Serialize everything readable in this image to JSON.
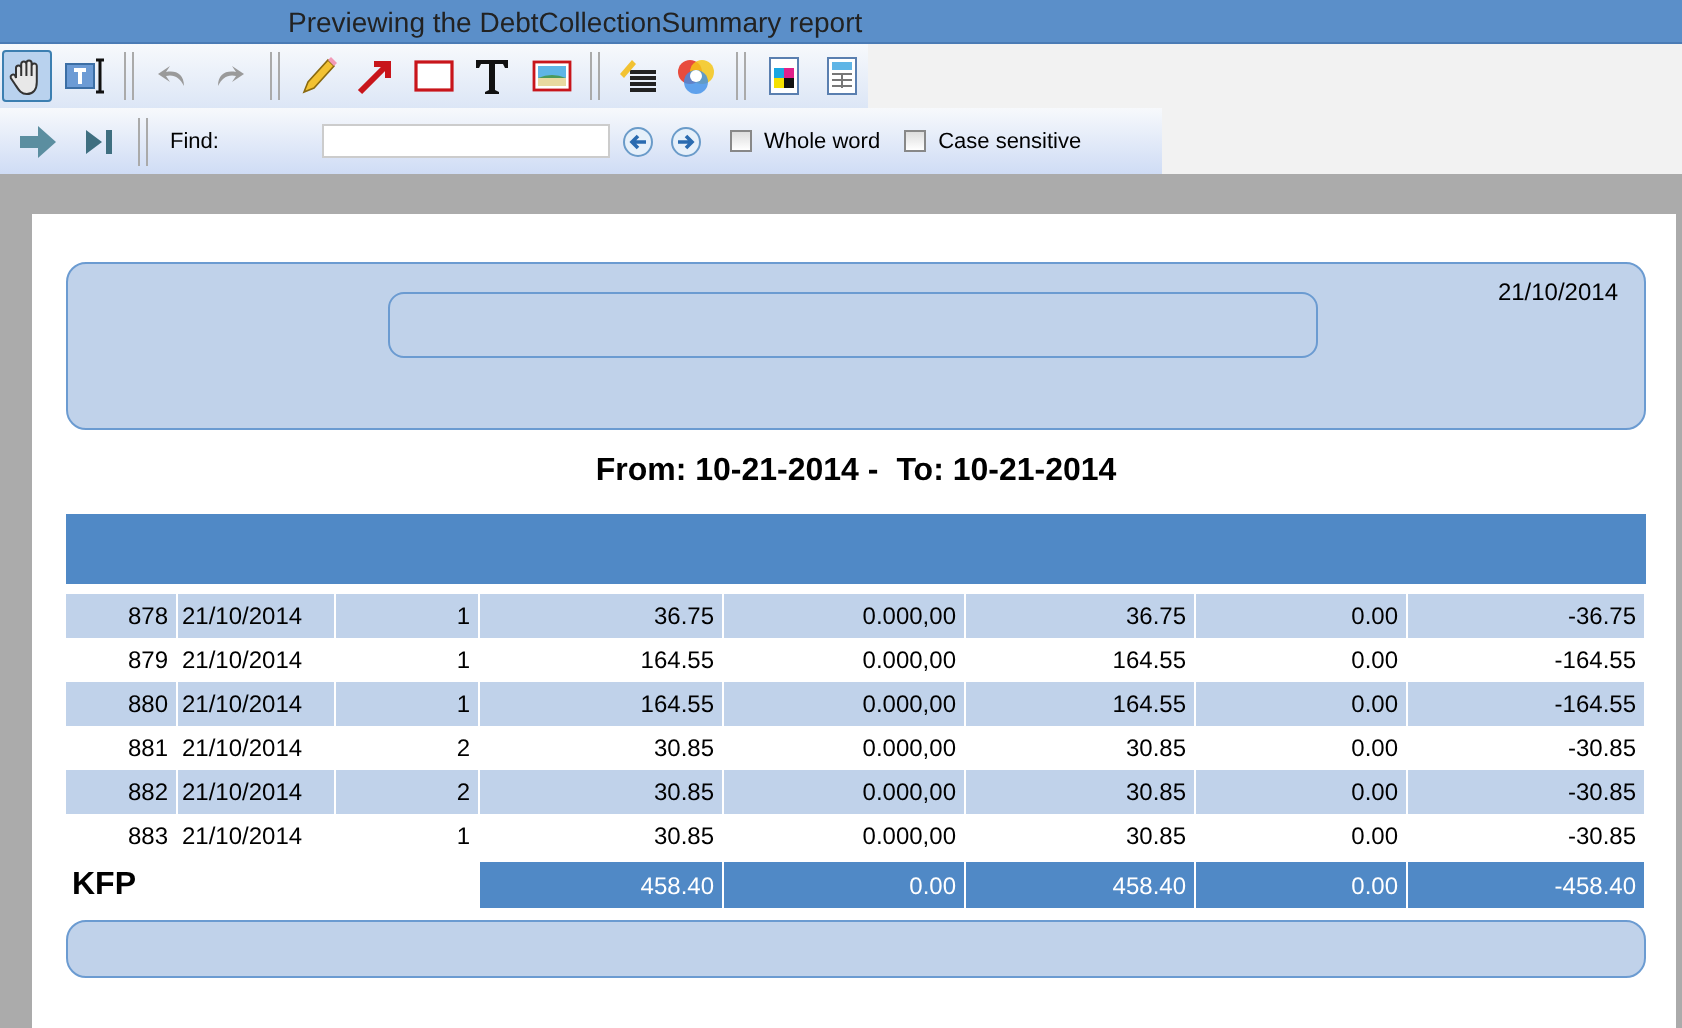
{
  "window": {
    "title": "Previewing the DebtCollectionSummary report"
  },
  "find_bar": {
    "label": "Find:",
    "checkboxes": [
      {
        "label": "Whole word",
        "checked": false
      },
      {
        "label": "Case sensitive",
        "checked": false
      }
    ]
  },
  "report": {
    "date": "21/10/2014",
    "range_from": "From: 10-21-2014 -",
    "range_to": "To: 10-21-2014",
    "rows": [
      [
        "878",
        "21/10/2014",
        "1",
        "36.75",
        "0.000,00",
        "36.75",
        "0.00",
        "-36.75"
      ],
      [
        "879",
        "21/10/2014",
        "1",
        "164.55",
        "0.000,00",
        "164.55",
        "0.00",
        "-164.55"
      ],
      [
        "880",
        "21/10/2014",
        "1",
        "164.55",
        "0.000,00",
        "164.55",
        "0.00",
        "-164.55"
      ],
      [
        "881",
        "21/10/2014",
        "2",
        "30.85",
        "0.000,00",
        "30.85",
        "0.00",
        "-30.85"
      ],
      [
        "882",
        "21/10/2014",
        "2",
        "30.85",
        "0.000,00",
        "30.85",
        "0.00",
        "-30.85"
      ],
      [
        "883",
        "21/10/2014",
        "1",
        "30.85",
        "0.000,00",
        "30.85",
        "0.00",
        "-30.85"
      ]
    ],
    "totals": {
      "label": "KFP",
      "values": [
        "458.40",
        "0.00",
        "458.40",
        "0.00",
        "-458.40"
      ]
    }
  }
}
